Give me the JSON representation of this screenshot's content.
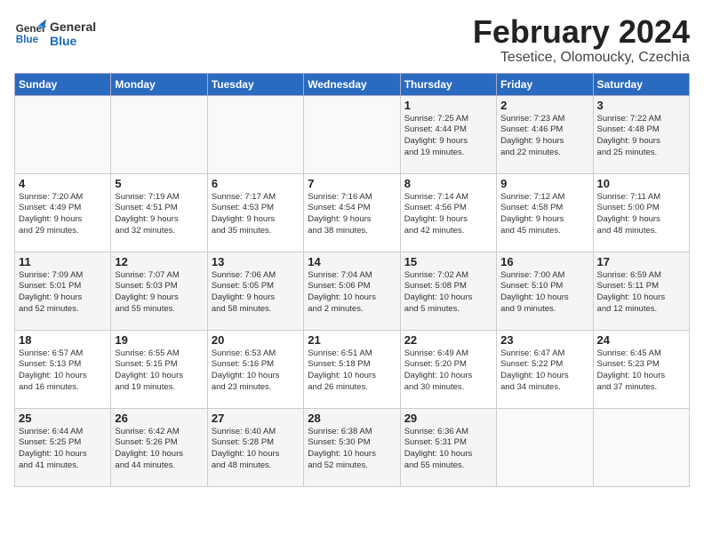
{
  "logo": {
    "text_general": "General",
    "text_blue": "Blue"
  },
  "title": "February 2024",
  "subtitle": "Tesetice, Olomoucky, Czechia",
  "days_of_week": [
    "Sunday",
    "Monday",
    "Tuesday",
    "Wednesday",
    "Thursday",
    "Friday",
    "Saturday"
  ],
  "weeks": [
    [
      {
        "num": "",
        "info": "",
        "empty": true
      },
      {
        "num": "",
        "info": "",
        "empty": true
      },
      {
        "num": "",
        "info": "",
        "empty": true
      },
      {
        "num": "",
        "info": "",
        "empty": true
      },
      {
        "num": "1",
        "info": "Sunrise: 7:25 AM\nSunset: 4:44 PM\nDaylight: 9 hours\nand 19 minutes."
      },
      {
        "num": "2",
        "info": "Sunrise: 7:23 AM\nSunset: 4:46 PM\nDaylight: 9 hours\nand 22 minutes."
      },
      {
        "num": "3",
        "info": "Sunrise: 7:22 AM\nSunset: 4:48 PM\nDaylight: 9 hours\nand 25 minutes."
      }
    ],
    [
      {
        "num": "4",
        "info": "Sunrise: 7:20 AM\nSunset: 4:49 PM\nDaylight: 9 hours\nand 29 minutes."
      },
      {
        "num": "5",
        "info": "Sunrise: 7:19 AM\nSunset: 4:51 PM\nDaylight: 9 hours\nand 32 minutes."
      },
      {
        "num": "6",
        "info": "Sunrise: 7:17 AM\nSunset: 4:53 PM\nDaylight: 9 hours\nand 35 minutes."
      },
      {
        "num": "7",
        "info": "Sunrise: 7:16 AM\nSunset: 4:54 PM\nDaylight: 9 hours\nand 38 minutes."
      },
      {
        "num": "8",
        "info": "Sunrise: 7:14 AM\nSunset: 4:56 PM\nDaylight: 9 hours\nand 42 minutes."
      },
      {
        "num": "9",
        "info": "Sunrise: 7:12 AM\nSunset: 4:58 PM\nDaylight: 9 hours\nand 45 minutes."
      },
      {
        "num": "10",
        "info": "Sunrise: 7:11 AM\nSunset: 5:00 PM\nDaylight: 9 hours\nand 48 minutes."
      }
    ],
    [
      {
        "num": "11",
        "info": "Sunrise: 7:09 AM\nSunset: 5:01 PM\nDaylight: 9 hours\nand 52 minutes."
      },
      {
        "num": "12",
        "info": "Sunrise: 7:07 AM\nSunset: 5:03 PM\nDaylight: 9 hours\nand 55 minutes."
      },
      {
        "num": "13",
        "info": "Sunrise: 7:06 AM\nSunset: 5:05 PM\nDaylight: 9 hours\nand 58 minutes."
      },
      {
        "num": "14",
        "info": "Sunrise: 7:04 AM\nSunset: 5:06 PM\nDaylight: 10 hours\nand 2 minutes."
      },
      {
        "num": "15",
        "info": "Sunrise: 7:02 AM\nSunset: 5:08 PM\nDaylight: 10 hours\nand 5 minutes."
      },
      {
        "num": "16",
        "info": "Sunrise: 7:00 AM\nSunset: 5:10 PM\nDaylight: 10 hours\nand 9 minutes."
      },
      {
        "num": "17",
        "info": "Sunrise: 6:59 AM\nSunset: 5:11 PM\nDaylight: 10 hours\nand 12 minutes."
      }
    ],
    [
      {
        "num": "18",
        "info": "Sunrise: 6:57 AM\nSunset: 5:13 PM\nDaylight: 10 hours\nand 16 minutes."
      },
      {
        "num": "19",
        "info": "Sunrise: 6:55 AM\nSunset: 5:15 PM\nDaylight: 10 hours\nand 19 minutes."
      },
      {
        "num": "20",
        "info": "Sunrise: 6:53 AM\nSunset: 5:16 PM\nDaylight: 10 hours\nand 23 minutes."
      },
      {
        "num": "21",
        "info": "Sunrise: 6:51 AM\nSunset: 5:18 PM\nDaylight: 10 hours\nand 26 minutes."
      },
      {
        "num": "22",
        "info": "Sunrise: 6:49 AM\nSunset: 5:20 PM\nDaylight: 10 hours\nand 30 minutes."
      },
      {
        "num": "23",
        "info": "Sunrise: 6:47 AM\nSunset: 5:22 PM\nDaylight: 10 hours\nand 34 minutes."
      },
      {
        "num": "24",
        "info": "Sunrise: 6:45 AM\nSunset: 5:23 PM\nDaylight: 10 hours\nand 37 minutes."
      }
    ],
    [
      {
        "num": "25",
        "info": "Sunrise: 6:44 AM\nSunset: 5:25 PM\nDaylight: 10 hours\nand 41 minutes."
      },
      {
        "num": "26",
        "info": "Sunrise: 6:42 AM\nSunset: 5:26 PM\nDaylight: 10 hours\nand 44 minutes."
      },
      {
        "num": "27",
        "info": "Sunrise: 6:40 AM\nSunset: 5:28 PM\nDaylight: 10 hours\nand 48 minutes."
      },
      {
        "num": "28",
        "info": "Sunrise: 6:38 AM\nSunset: 5:30 PM\nDaylight: 10 hours\nand 52 minutes."
      },
      {
        "num": "29",
        "info": "Sunrise: 6:36 AM\nSunset: 5:31 PM\nDaylight: 10 hours\nand 55 minutes."
      },
      {
        "num": "",
        "info": "",
        "empty": true
      },
      {
        "num": "",
        "info": "",
        "empty": true
      }
    ]
  ]
}
